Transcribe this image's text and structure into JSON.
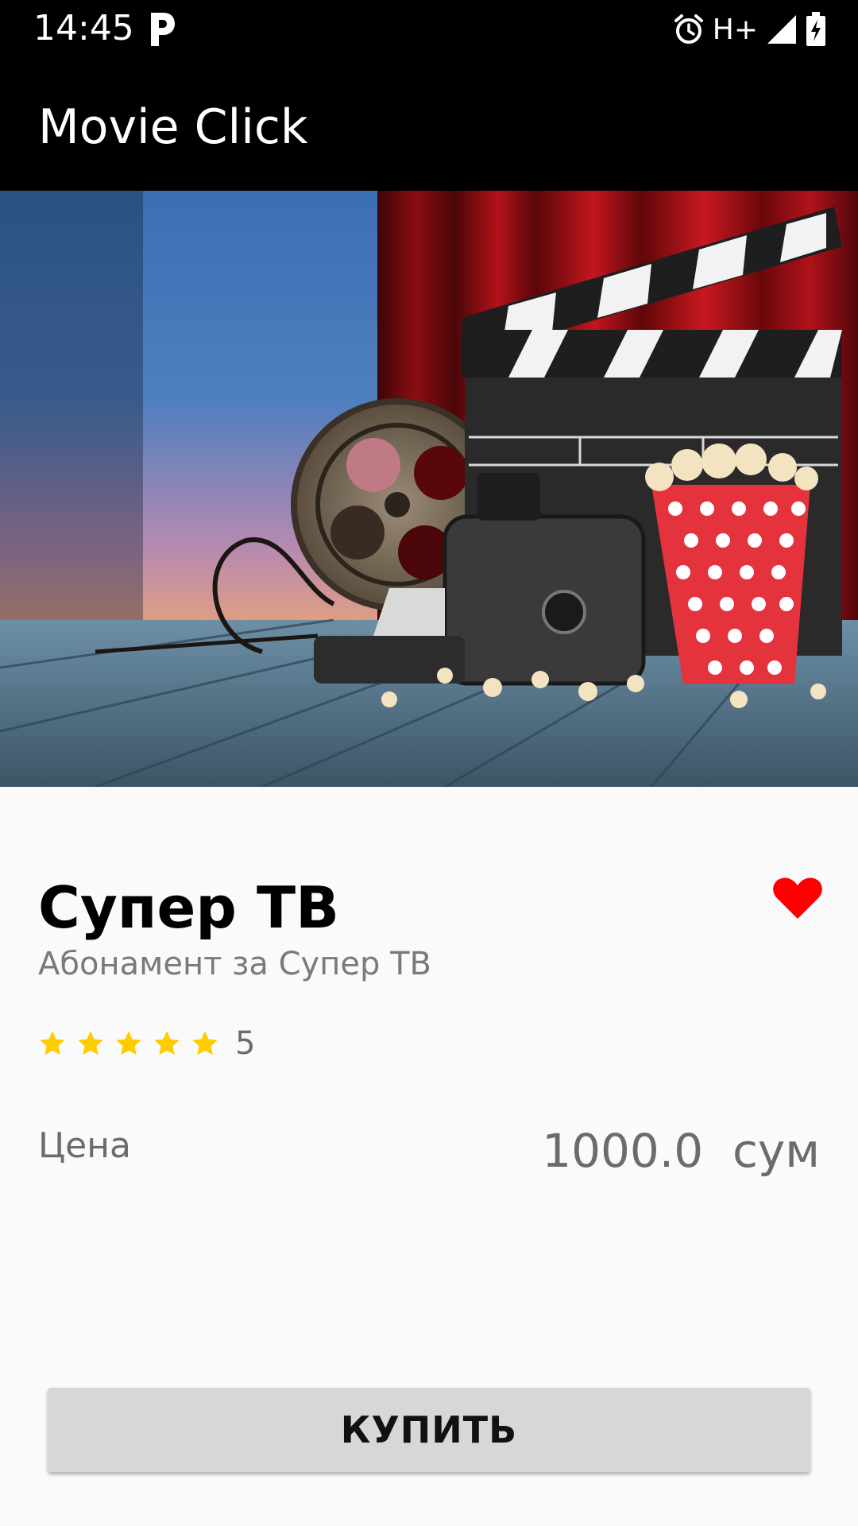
{
  "status_bar": {
    "time": "14:45",
    "network": "H+",
    "icons": [
      "parking-p-icon",
      "alarm-icon",
      "signal-icon",
      "battery-charging-icon"
    ]
  },
  "app_bar": {
    "title": "Movie Click"
  },
  "hero_image": {
    "description_icon": "cinema-image"
  },
  "product": {
    "title": "Супер ТВ",
    "subtitle": "Абонамент за Супер ТВ",
    "favorite_icon": "heart-icon",
    "favorite_color": "#ff0000",
    "rating": {
      "stars": 5,
      "value": "5",
      "star_color": "#ffcc00"
    },
    "price_label": "Цена",
    "price_value": "1000.0  сум"
  },
  "actions": {
    "buy_label": "КУПИТЬ"
  }
}
